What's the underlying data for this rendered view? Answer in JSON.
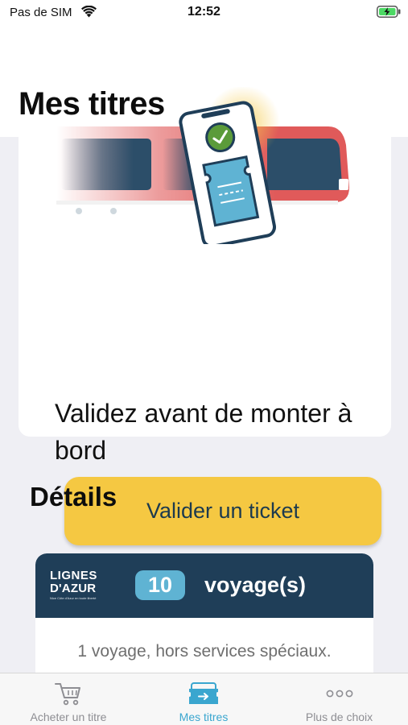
{
  "status_bar": {
    "carrier": "Pas de SIM",
    "time": "12:52"
  },
  "page": {
    "title": "Mes titres"
  },
  "hero": {
    "message": "Validez avant de monter à bord",
    "button_label": "Valider un ticket"
  },
  "details": {
    "heading": "Détails",
    "ticket": {
      "brand_line1": "LIGNES",
      "brand_line2": "D'AZUR",
      "brand_tagline": "Nice Côte d'Azur en toute liberté",
      "count": "10",
      "unit_label": "voyage(s)",
      "description": "1 voyage, hors services spéciaux."
    }
  },
  "tab_bar": {
    "items": [
      {
        "label": "Acheter un titre",
        "icon": "cart-icon"
      },
      {
        "label": "Mes titres",
        "icon": "tickets-icon",
        "active": true
      },
      {
        "label": "Plus de choix",
        "icon": "more-dots-icon"
      }
    ]
  },
  "colors": {
    "accent": "#3aa6cf",
    "button": "#f5c842",
    "ticket_header": "#1f3e58",
    "badge": "#5fb3d3",
    "train_red": "#e05a5a"
  }
}
